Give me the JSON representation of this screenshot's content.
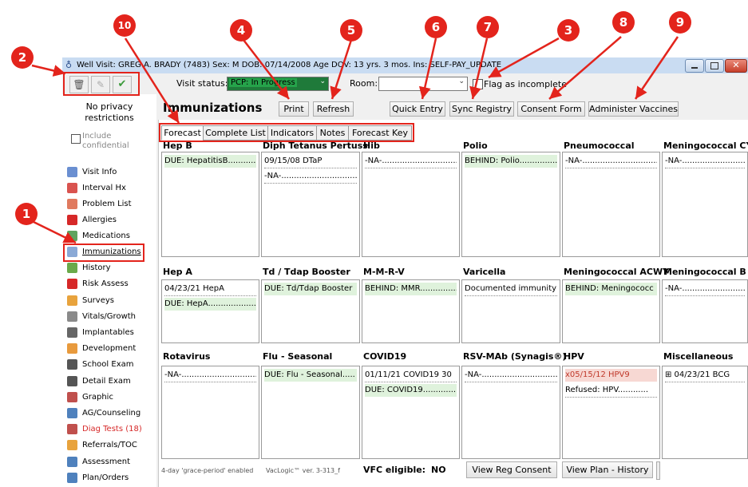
{
  "window": {
    "title": "Well Visit: GREG A. BRADY (7483)  Sex: M  DOB: 07/14/2008  Age DOV: 13 yrs. 3 mos.  Ins: SELF-PAY_UPDATE"
  },
  "toolbar": {
    "visit_status_label": "Visit status:",
    "visit_status_value": "PCP: In Progress",
    "room_label": "Room:",
    "flag_label": "Flag as incomplete",
    "trash_icon": "trash-icon",
    "edit_icon": "pencil-icon",
    "check_icon": "check-icon"
  },
  "privacy": {
    "text": "No privacy restrictions",
    "include_confidential": "Include confidential"
  },
  "page": {
    "title": "Immunizations",
    "buttons": {
      "print": "Print",
      "refresh": "Refresh",
      "quick_entry": "Quick Entry",
      "sync_registry": "Sync Registry",
      "consent_form": "Consent Form",
      "administer_vaccines": "Administer Vaccines"
    }
  },
  "tabs": [
    "Forecast",
    "Complete List",
    "Indicators",
    "Notes",
    "Forecast Key"
  ],
  "sidebar": {
    "items": [
      {
        "label": "Visit Info",
        "icon": "visit-info-icon",
        "color": "#6a8fd1"
      },
      {
        "label": "Interval Hx",
        "icon": "interval-hx-icon",
        "color": "#d9534f"
      },
      {
        "label": "Problem List",
        "icon": "problem-list-icon",
        "color": "#e07a5f"
      },
      {
        "label": "Allergies",
        "icon": "allergies-icon",
        "color": "#d62828"
      },
      {
        "label": "Medications",
        "icon": "medications-icon",
        "color": "#5fa35f"
      },
      {
        "label": "Immunizations",
        "icon": "syringe-icon",
        "color": "#8aa9d6"
      },
      {
        "label": "History",
        "icon": "history-icon",
        "color": "#6aaa4a"
      },
      {
        "label": "Risk Assess",
        "icon": "risk-assess-icon",
        "color": "#d62828"
      },
      {
        "label": "Surveys",
        "icon": "surveys-icon",
        "color": "#e8a33d"
      },
      {
        "label": "Vitals/Growth",
        "icon": "vitals-icon",
        "color": "#8a8a8a"
      },
      {
        "label": "Implantables",
        "icon": "implantables-icon",
        "color": "#666666"
      },
      {
        "label": "Development",
        "icon": "development-icon",
        "color": "#e89a3d"
      },
      {
        "label": "School Exam",
        "icon": "school-exam-icon",
        "color": "#555555"
      },
      {
        "label": "Detail Exam",
        "icon": "detail-exam-icon",
        "color": "#555555"
      },
      {
        "label": "Graphic",
        "icon": "graphic-icon",
        "color": "#c0504d"
      },
      {
        "label": "AG/Counseling",
        "icon": "counseling-icon",
        "color": "#4f81bd"
      },
      {
        "label": "Diag Tests (18)",
        "icon": "diag-tests-icon",
        "color": "#c0504d",
        "alert": true
      },
      {
        "label": "Referrals/TOC",
        "icon": "referrals-icon",
        "color": "#e8a33d"
      },
      {
        "label": "Assessment",
        "icon": "assessment-icon",
        "color": "#4f81bd"
      },
      {
        "label": "Plan/Orders",
        "icon": "plan-orders-icon",
        "color": "#4f81bd"
      }
    ]
  },
  "groups": [
    {
      "name": "Hep B",
      "entries": [
        {
          "text": "DUE: HepatitisB............",
          "style": "green"
        }
      ]
    },
    {
      "name": "Diph Tetanus Pertuss",
      "entries": [
        {
          "text": "09/15/08  DTaP",
          "style": "plain"
        },
        {
          "text": "-NA-...............................",
          "style": "plain"
        }
      ]
    },
    {
      "name": "Hib",
      "entries": [
        {
          "text": "-NA-...............................",
          "style": "plain"
        }
      ]
    },
    {
      "name": "Polio",
      "entries": [
        {
          "text": "BEHIND: Polio................",
          "style": "green"
        }
      ]
    },
    {
      "name": "Pneumococcal",
      "entries": [
        {
          "text": "-NA-...............................",
          "style": "plain"
        }
      ]
    },
    {
      "name": "Meningococcal CY",
      "entries": [
        {
          "text": "-NA-...........................",
          "style": "plain"
        }
      ]
    },
    {
      "name": "Hep A",
      "entries": [
        {
          "text": "04/23/21  HepA",
          "style": "plain"
        },
        {
          "text": "DUE: HepA......................",
          "style": "green"
        }
      ]
    },
    {
      "name": "Td / Tdap Booster",
      "entries": [
        {
          "text": "DUE: Td/Tdap Booster",
          "style": "green"
        }
      ]
    },
    {
      "name": "M-M-R-V",
      "entries": [
        {
          "text": "BEHIND: MMR...............",
          "style": "green"
        }
      ]
    },
    {
      "name": "Varicella",
      "entries": [
        {
          "text": "Documented immunity",
          "style": "plain"
        }
      ]
    },
    {
      "name": "Meningococcal ACWY",
      "entries": [
        {
          "text": "BEHIND: Meningococc",
          "style": "green"
        }
      ]
    },
    {
      "name": "Meningococcal B",
      "entries": [
        {
          "text": "-NA-...........................",
          "style": "plain"
        }
      ]
    },
    {
      "name": "Rotavirus",
      "entries": [
        {
          "text": "-NA-...............................",
          "style": "plain"
        }
      ]
    },
    {
      "name": "Flu - Seasonal",
      "entries": [
        {
          "text": "DUE: Flu - Seasonal.....",
          "style": "green"
        }
      ]
    },
    {
      "name": "COVID19",
      "entries": [
        {
          "text": "01/11/21  COVID19 30",
          "style": "plain"
        },
        {
          "text": "DUE: COVID19...............",
          "style": "green"
        }
      ]
    },
    {
      "name": "RSV-MAb (Synagis®)",
      "entries": [
        {
          "text": "-NA-...............................",
          "style": "plain"
        }
      ]
    },
    {
      "name": "HPV",
      "entries": [
        {
          "text": "x05/15/12  HPV9",
          "style": "pink"
        },
        {
          "text": "Refused:  HPV............",
          "style": "plain"
        }
      ]
    },
    {
      "name": "Miscellaneous",
      "entries": [
        {
          "text": "⊞ 04/23/21 BCG",
          "style": "plain"
        }
      ]
    }
  ],
  "footer": {
    "grace": "4-day 'grace-period' enabled",
    "version": "VacLogic™  ver. 3-313_f",
    "vfc_label": "VFC eligible:",
    "vfc_value": "NO",
    "view_reg_consent": "View Reg Consent",
    "view_plan_history": "View Plan - History"
  },
  "callouts": [
    "1",
    "2",
    "3",
    "4",
    "5",
    "6",
    "7",
    "8",
    "9",
    "10"
  ],
  "colors": {
    "callout": "#e3241c",
    "green_entry": "#dff2dc",
    "pink_entry": "#f7d8d3",
    "status_bg": "#1f7a3a"
  }
}
